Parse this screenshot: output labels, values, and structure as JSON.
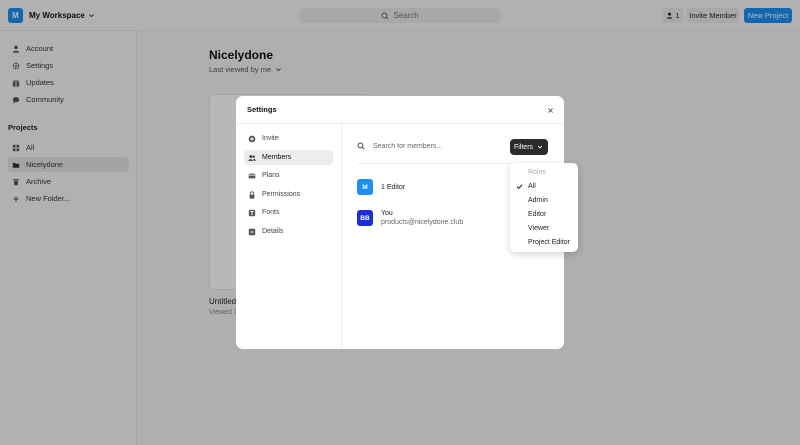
{
  "topbar": {
    "workspace_initial": "M",
    "workspace_name": "My Workspace",
    "search_placeholder": "Search",
    "member_count": "1",
    "invite_label": "Invite Member",
    "new_project_label": "New Project"
  },
  "sidebar": {
    "items": [
      {
        "label": "Account",
        "icon": "user-icon"
      },
      {
        "label": "Settings",
        "icon": "gear-icon"
      },
      {
        "label": "Updates",
        "icon": "gift-icon"
      },
      {
        "label": "Community",
        "icon": "chat-icon"
      }
    ],
    "projects_heading": "Projects",
    "projects": [
      {
        "label": "All",
        "icon": "grid-icon"
      },
      {
        "label": "Nicelydone",
        "icon": "folder-icon"
      },
      {
        "label": "Archive",
        "icon": "trash-icon"
      },
      {
        "label": "New Folder...",
        "icon": "plus-icon"
      }
    ]
  },
  "main": {
    "title": "Nicelydone",
    "subtitle": "Last viewed by me",
    "card_title": "Untitled",
    "card_sub": "Viewed 1"
  },
  "modal": {
    "title": "Settings",
    "menu": [
      {
        "label": "Invite",
        "icon": "plus-circle-icon"
      },
      {
        "label": "Members",
        "icon": "users-icon"
      },
      {
        "label": "Plans",
        "icon": "card-icon"
      },
      {
        "label": "Permissions",
        "icon": "lock-icon"
      },
      {
        "label": "Fonts",
        "icon": "font-icon"
      },
      {
        "label": "Details",
        "icon": "details-icon"
      }
    ],
    "search_placeholder": "Search for members...",
    "filters_label": "Filters",
    "members": [
      {
        "initials": "M",
        "name": "1 Editor",
        "email": "",
        "color": "#1b8ff5"
      },
      {
        "initials": "BB",
        "name": "You",
        "email": "products@nicelydone.club",
        "color": "#1a2fd8"
      }
    ]
  },
  "filters_dropdown": {
    "heading": "Roles",
    "options": [
      "All",
      "Admin",
      "Editor",
      "Viewer",
      "Project Editor"
    ],
    "selected": "All"
  },
  "colors": {
    "accent": "#1b8ff5",
    "dark_button": "#2b2b2b"
  }
}
